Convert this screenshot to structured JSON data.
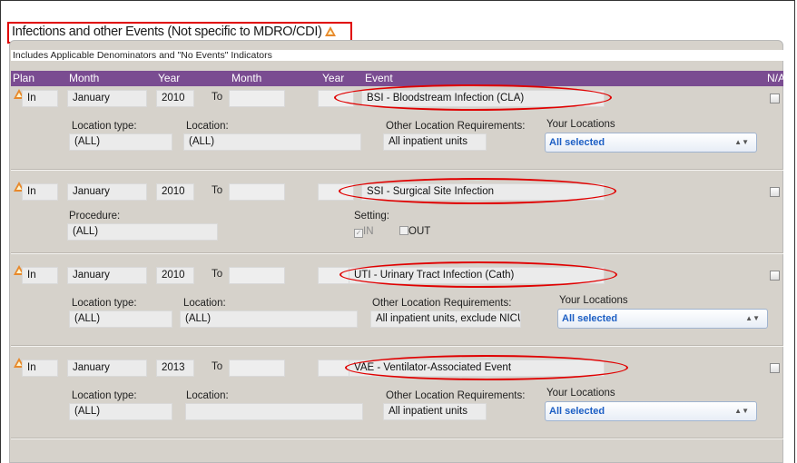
{
  "header": {
    "title": "Infections and other Events (Not specific to MDRO/CDI)",
    "warning_icon": "warning-triangle-icon",
    "subtitle": "Includes Applicable Denominators and \"No Events\" Indicators"
  },
  "columns": {
    "plan": "Plan",
    "month1": "Month",
    "year1": "Year",
    "month2": "Month",
    "year2": "Year",
    "event": "Event",
    "na": "N/A"
  },
  "rows": [
    {
      "plan": "In",
      "month": "January",
      "year": "2010",
      "to": "To",
      "event": "BSI - Bloodstream Infection (CLA)",
      "location_type_label": "Location type:",
      "location_type": "(ALL)",
      "location_label": "Location:",
      "location": "(ALL)",
      "other_req_label": "Other Location Requirements:",
      "other_req": "All inpatient units",
      "your_locations_label": "Your Locations",
      "your_locations": "All selected"
    },
    {
      "plan": "In",
      "month": "January",
      "year": "2010",
      "to": "To",
      "event": "SSI - Surgical Site Infection",
      "procedure_label": "Procedure:",
      "procedure": "(ALL)",
      "setting_label": "Setting:",
      "setting_in": "IN",
      "setting_out": "OUT"
    },
    {
      "plan": "In",
      "month": "January",
      "year": "2010",
      "to": "To",
      "event": "UTI - Urinary Tract Infection (Cath)",
      "location_type_label": "Location type:",
      "location_type": "(ALL)",
      "location_label": "Location:",
      "location": "(ALL)",
      "other_req_label": "Other Location Requirements:",
      "other_req": "All inpatient units, exclude NICUs",
      "your_locations_label": "Your Locations",
      "your_locations": "All selected"
    },
    {
      "plan": "In",
      "month": "January",
      "year": "2013",
      "to": "To",
      "event": "VAE - Ventilator-Associated Event",
      "location_type_label": "Location type:",
      "location_type": "(ALL)",
      "location_label": "Location:",
      "location": "",
      "other_req_label": "Other Location Requirements:",
      "other_req": "All inpatient units",
      "your_locations_label": "Your Locations",
      "your_locations": "All selected"
    }
  ],
  "colors": {
    "header_bar": "#7a4c91",
    "panel_bg": "#d6d2cb",
    "highlight": "#e00000",
    "warning": "#e8892b",
    "select_text": "#1d5fc4"
  }
}
